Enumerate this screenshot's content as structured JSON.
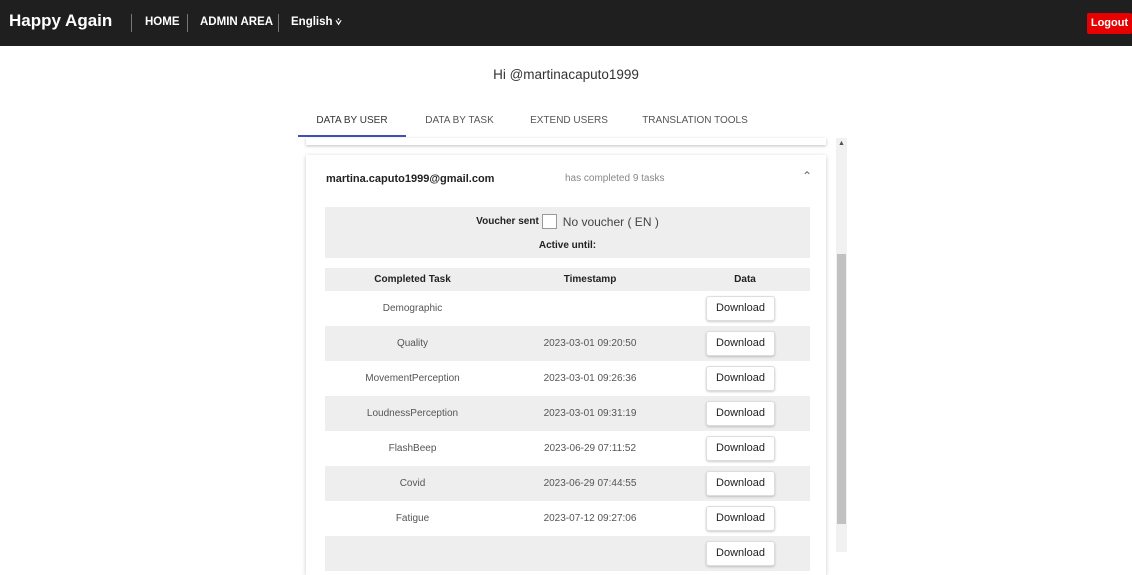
{
  "nav": {
    "brand": "Happy Again",
    "home": "HOME",
    "admin": "ADMIN AREA",
    "language": "English",
    "language_arrow": "⩒",
    "logout": "Logout"
  },
  "colors": {
    "navbar": "#1f1f1f",
    "logout": "#e60000",
    "tab_indicator": "#3f51b5"
  },
  "greeting": "Hi @martinacaputo1999",
  "tabs": [
    {
      "label": "DATA BY USER",
      "active": true
    },
    {
      "label": "DATA BY TASK",
      "active": false
    },
    {
      "label": "EXTEND USERS",
      "active": false
    },
    {
      "label": "TRANSLATION TOOLS",
      "active": false
    }
  ],
  "user_card": {
    "email": "martina.caputo1999@gmail.com",
    "status": "has completed 9 tasks",
    "expand_icon": "chevron-up-icon",
    "voucher_label": "Voucher sent",
    "voucher_status": "No voucher ( EN )",
    "active_until_label": "Active until:"
  },
  "table": {
    "headers": {
      "task": "Completed Task",
      "timestamp": "Timestamp",
      "data": "Data"
    },
    "button_label": "Download",
    "rows": [
      {
        "task": "Demographic",
        "timestamp": ""
      },
      {
        "task": "Quality",
        "timestamp": "2023-03-01 09:20:50"
      },
      {
        "task": "MovementPerception",
        "timestamp": "2023-03-01 09:26:36"
      },
      {
        "task": "LoudnessPerception",
        "timestamp": "2023-03-01 09:31:19"
      },
      {
        "task": "FlashBeep",
        "timestamp": "2023-06-29 07:11:52"
      },
      {
        "task": "Covid",
        "timestamp": "2023-06-29 07:44:55"
      },
      {
        "task": "Fatigue",
        "timestamp": "2023-07-12 09:27:06"
      }
    ]
  }
}
